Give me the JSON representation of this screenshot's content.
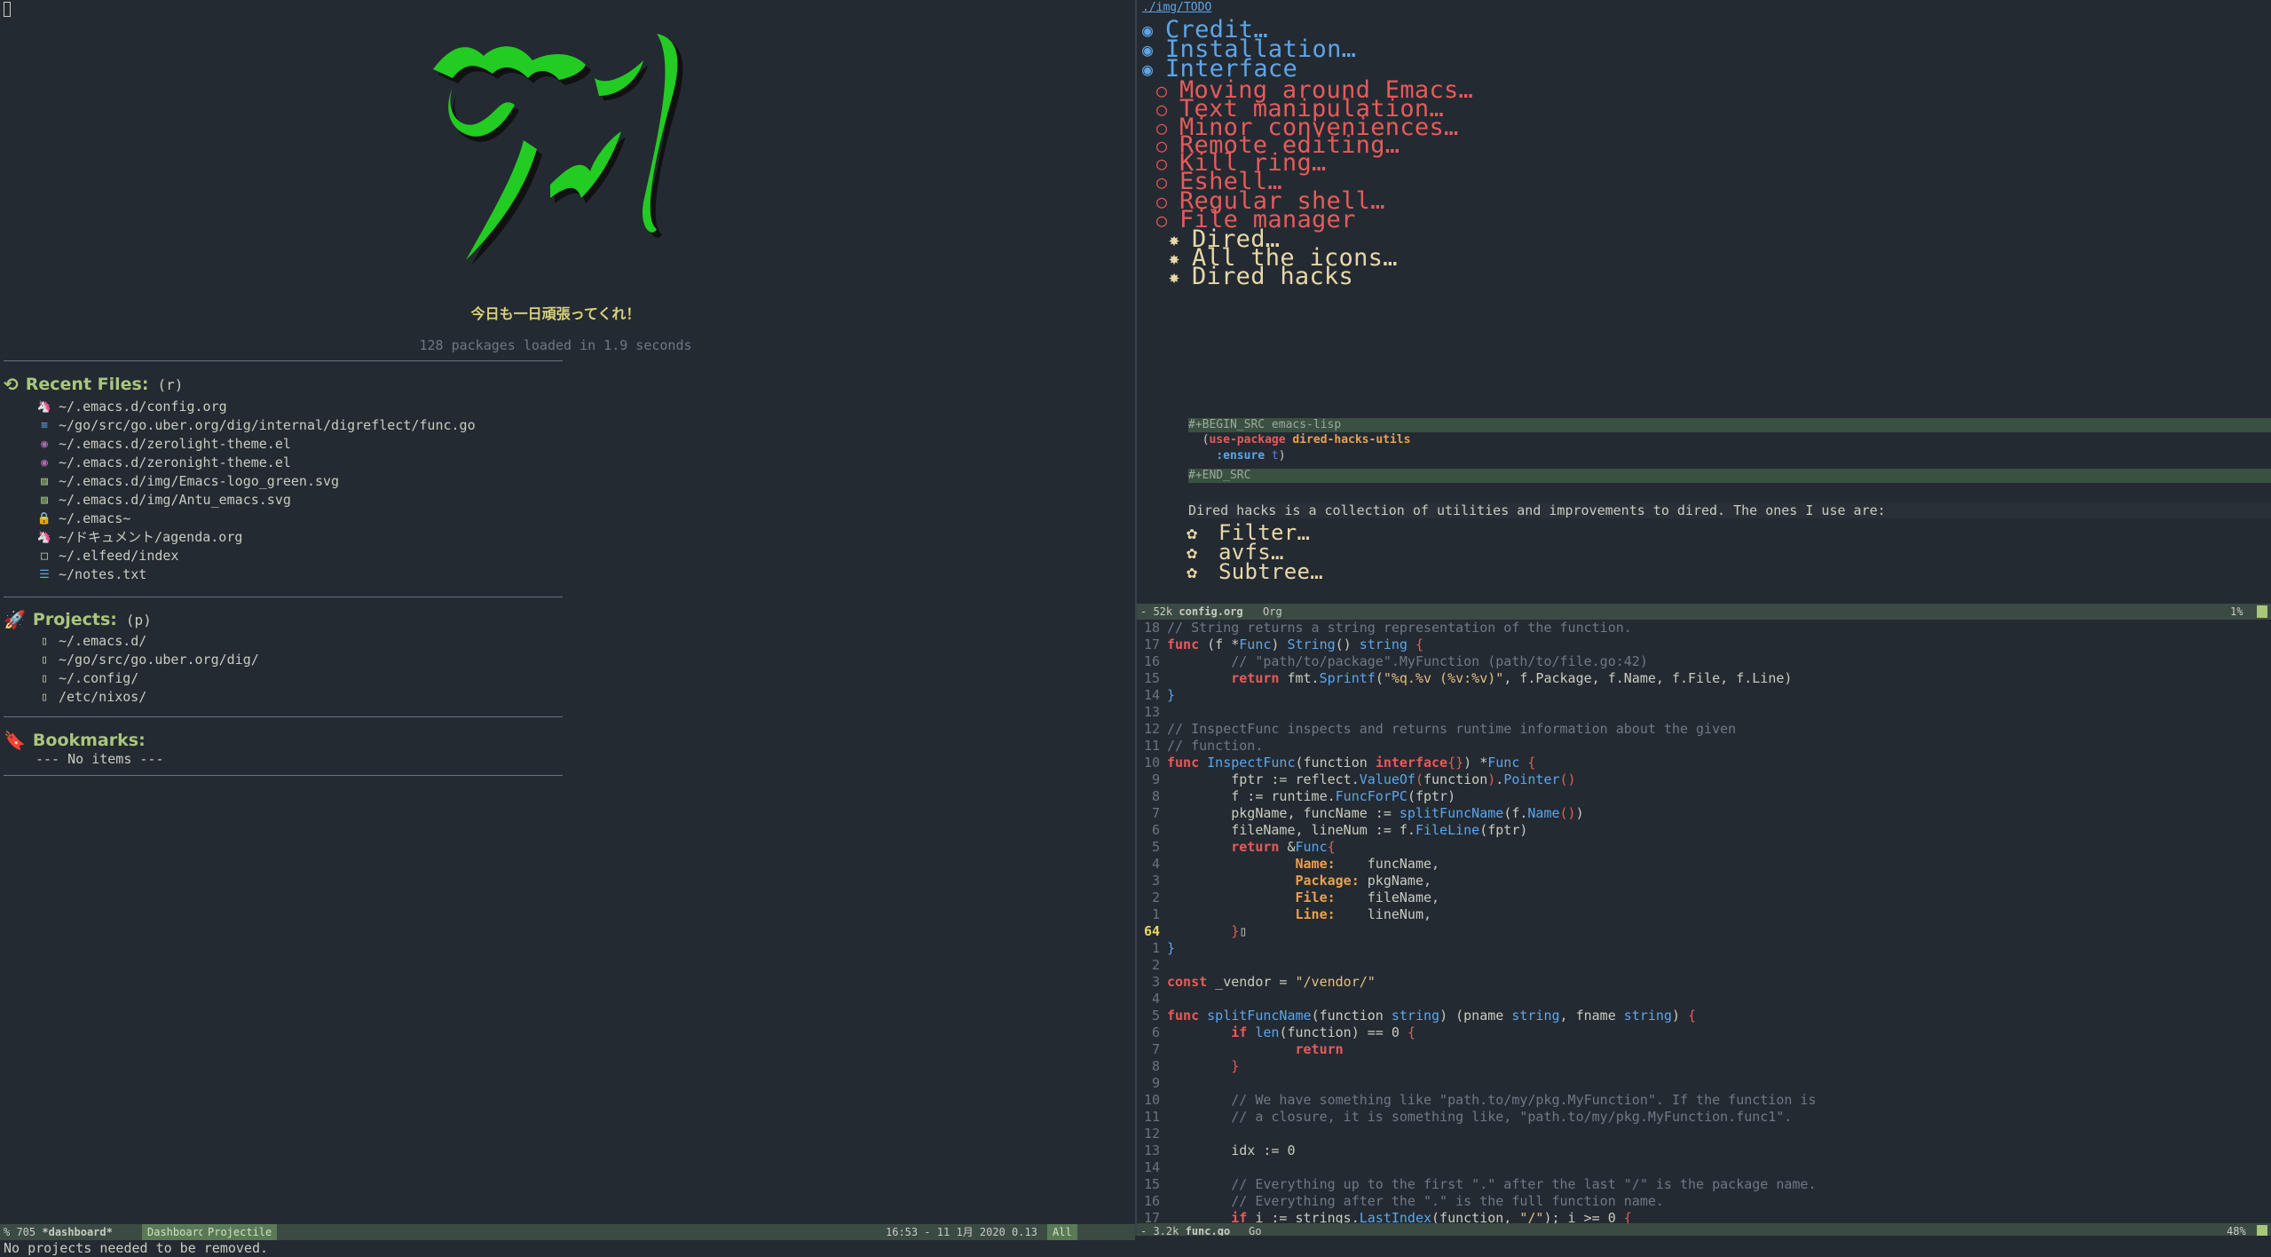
{
  "dashboard": {
    "banner_title": "今日も一日頑張ってくれ！",
    "loaded_text": "128 packages loaded in 1.9 seconds",
    "recent": {
      "title": "Recent Files:",
      "key": "(r)",
      "items": [
        {
          "path": "~/.emacs.d/config.org",
          "icon": "unicorn-icon",
          "glyph": "🦄",
          "color": "#e8d8a8"
        },
        {
          "path": "~/go/src/go.uber.org/dig/internal/digreflect/func.go",
          "icon": "go-file-icon",
          "glyph": "≡",
          "color": "#5ea5e8"
        },
        {
          "path": "~/.emacs.d/zerolight-theme.el",
          "icon": "elisp-icon",
          "glyph": "◉",
          "color": "#b06ab0"
        },
        {
          "path": "~/.emacs.d/zeronight-theme.el",
          "icon": "elisp-icon",
          "glyph": "◉",
          "color": "#b06ab0"
        },
        {
          "path": "~/.emacs.d/img/Emacs-logo_green.svg",
          "icon": "svg-image-icon",
          "glyph": "▨",
          "color": "#a9c67c"
        },
        {
          "path": "~/.emacs.d/img/Antu_emacs.svg",
          "icon": "svg-image-icon",
          "glyph": "▨",
          "color": "#a9c67c"
        },
        {
          "path": "~/.emacs~",
          "icon": "lock-icon",
          "glyph": "🔒",
          "color": "#e85a5a"
        },
        {
          "path": "~/ドキュメント/agenda.org",
          "icon": "unicorn-icon",
          "glyph": "🦄",
          "color": "#e8d8a8"
        },
        {
          "path": "~/.elfeed/index",
          "icon": "file-icon",
          "glyph": "□",
          "color": "#c8ccc0"
        },
        {
          "path": "~/notes.txt",
          "icon": "text-file-icon",
          "glyph": "☰",
          "color": "#5ea5e8"
        }
      ]
    },
    "projects": {
      "title": "Projects:",
      "key": "(p)",
      "items": [
        {
          "path": "~/.emacs.d/",
          "icon": "repo-icon",
          "glyph": "▯"
        },
        {
          "path": "~/go/src/go.uber.org/dig/",
          "icon": "repo-icon",
          "glyph": "▯"
        },
        {
          "path": "~/.config/",
          "icon": "repo-icon",
          "glyph": "▯"
        },
        {
          "path": "/etc/nixos/",
          "icon": "repo-icon",
          "glyph": "▯"
        }
      ]
    },
    "bookmarks": {
      "title": "Bookmarks:",
      "empty": "--- No items ---"
    }
  },
  "org": {
    "breadcrumb": "./img/TODO",
    "headings": [
      {
        "level": 1,
        "text": "Credit…",
        "bullet": "◉"
      },
      {
        "level": 1,
        "text": "Installation…",
        "bullet": "◉"
      },
      {
        "level": 1,
        "text": "Interface",
        "bullet": "◉"
      },
      {
        "level": 2,
        "text": "Moving around Emacs…",
        "bullet": "○"
      },
      {
        "level": 2,
        "text": "Text manipulation…",
        "bullet": "○"
      },
      {
        "level": 2,
        "text": "Minor conveniences…",
        "bullet": "○"
      },
      {
        "level": 2,
        "text": "Remote editing…",
        "bullet": "○"
      },
      {
        "level": 2,
        "text": "Kill ring…",
        "bullet": "○"
      },
      {
        "level": 2,
        "text": "Eshell…",
        "bullet": "○"
      },
      {
        "level": 2,
        "text": "Regular shell…",
        "bullet": "○"
      },
      {
        "level": 2,
        "text": "File manager",
        "bullet": "○"
      },
      {
        "level": 3,
        "text": "Dired…",
        "bullet": "✸"
      },
      {
        "level": 3,
        "text": "All the icons…",
        "bullet": "✸"
      },
      {
        "level": 3,
        "text": "Dired hacks",
        "bullet": "✸"
      }
    ],
    "src_begin": "#+BEGIN_SRC emacs-lisp",
    "src_line1_open": "  (",
    "src_line1_kw": "use-package",
    "src_line1_pkg": " dired-hacks-utils",
    "src_line2_indent": "    ",
    "src_line2_kw": ":ensure",
    "src_line2_val": " t",
    "src_line2_close": ")",
    "src_end": "#+END_SRC",
    "prose": "Dired hacks is a collection of utilities and improvements to dired. The ones I use are:",
    "subheadings": [
      {
        "text": "Filter…",
        "bullet": "✿"
      },
      {
        "text": "avfs…",
        "bullet": "✿"
      },
      {
        "text": "Subtree…",
        "bullet": "✿"
      }
    ],
    "modeline": {
      "size": "52k",
      "buffer": "config.org",
      "mode": "Org",
      "percent": "1%"
    }
  },
  "code": {
    "lines": [
      {
        "n": "18",
        "segs": [
          [
            "cmt",
            "// String returns a string representation of the function."
          ]
        ]
      },
      {
        "n": "17",
        "segs": [
          [
            "kw",
            "func"
          ],
          [
            "",
            " (f *"
          ],
          [
            "typ",
            "Func"
          ],
          [
            "",
            ") "
          ],
          [
            "fn",
            "String"
          ],
          [
            "",
            "() "
          ],
          [
            "typ",
            "string"
          ],
          [
            "",
            " "
          ],
          [
            "pnc",
            "{"
          ]
        ]
      },
      {
        "n": "16",
        "segs": [
          [
            "",
            "        "
          ],
          [
            "cmt",
            "// \"path/to/package\".MyFunction (path/to/file.go:42)"
          ]
        ]
      },
      {
        "n": "15",
        "segs": [
          [
            "",
            "        "
          ],
          [
            "kw",
            "return"
          ],
          [
            "",
            " fmt."
          ],
          [
            "fn",
            "Sprintf"
          ],
          [
            "",
            "("
          ],
          [
            "str",
            "\"%q.%v (%v:%v)\""
          ],
          [
            "",
            ", f.Package, f.Name, f.File, f.Line)"
          ]
        ]
      },
      {
        "n": "14",
        "segs": [
          [
            "typ",
            "}"
          ]
        ]
      },
      {
        "n": "13",
        "segs": []
      },
      {
        "n": "12",
        "segs": [
          [
            "cmt",
            "// InspectFunc inspects and returns runtime information about the given"
          ]
        ]
      },
      {
        "n": "11",
        "segs": [
          [
            "cmt",
            "// function."
          ]
        ]
      },
      {
        "n": "10",
        "segs": [
          [
            "kw",
            "func"
          ],
          [
            "",
            " "
          ],
          [
            "fn",
            "InspectFunc"
          ],
          [
            "",
            "(function "
          ],
          [
            "kw",
            "interface"
          ],
          [
            "pnc",
            "{}"
          ],
          [
            "",
            ") *"
          ],
          [
            "typ",
            "Func"
          ],
          [
            "",
            " "
          ],
          [
            "pnc",
            "{"
          ]
        ]
      },
      {
        "n": "9",
        "segs": [
          [
            "",
            "        fptr := reflect."
          ],
          [
            "fn",
            "ValueOf"
          ],
          [
            "pnc",
            "("
          ],
          [
            "",
            "function"
          ],
          [
            "pnc",
            ")"
          ],
          [
            "",
            "."
          ],
          [
            "fn",
            "Pointer"
          ],
          [
            "pnc",
            "()"
          ]
        ]
      },
      {
        "n": "8",
        "segs": [
          [
            "",
            "        f := runtime."
          ],
          [
            "fn",
            "FuncForPC"
          ],
          [
            "",
            "(fptr)"
          ]
        ]
      },
      {
        "n": "7",
        "segs": [
          [
            "",
            "        pkgName, funcName := "
          ],
          [
            "fn",
            "splitFuncName"
          ],
          [
            "",
            "(f."
          ],
          [
            "fn",
            "Name"
          ],
          [
            "pnc",
            "()"
          ],
          [
            "",
            ")"
          ]
        ]
      },
      {
        "n": "6",
        "segs": [
          [
            "",
            "        fileName, lineNum := f."
          ],
          [
            "fn",
            "FileLine"
          ],
          [
            "",
            "(fptr)"
          ]
        ]
      },
      {
        "n": "5",
        "segs": [
          [
            "",
            "        "
          ],
          [
            "kw",
            "return"
          ],
          [
            "",
            " &"
          ],
          [
            "typ",
            "Func"
          ],
          [
            "pnc",
            "{"
          ]
        ]
      },
      {
        "n": "4",
        "segs": [
          [
            "",
            "                "
          ],
          [
            "fld",
            "Name:"
          ],
          [
            "",
            "    funcName,"
          ]
        ]
      },
      {
        "n": "3",
        "segs": [
          [
            "",
            "                "
          ],
          [
            "fld",
            "Package:"
          ],
          [
            "",
            " pkgName,"
          ]
        ]
      },
      {
        "n": "2",
        "segs": [
          [
            "",
            "                "
          ],
          [
            "fld",
            "File:"
          ],
          [
            "",
            "    fileName,"
          ]
        ]
      },
      {
        "n": "1",
        "segs": [
          [
            "",
            "                "
          ],
          [
            "fld",
            "Line:"
          ],
          [
            "",
            "    lineNum,"
          ]
        ]
      },
      {
        "n": "64",
        "cur": true,
        "segs": [
          [
            "",
            "        "
          ],
          [
            "pnc",
            "}"
          ],
          [
            "",
            "▯"
          ]
        ]
      },
      {
        "n": "1",
        "segs": [
          [
            "typ",
            "}"
          ]
        ]
      },
      {
        "n": "2",
        "segs": []
      },
      {
        "n": "3",
        "segs": [
          [
            "kw",
            "const"
          ],
          [
            "",
            " _vendor = "
          ],
          [
            "str",
            "\"/vendor/\""
          ]
        ]
      },
      {
        "n": "4",
        "segs": []
      },
      {
        "n": "5",
        "segs": [
          [
            "kw",
            "func"
          ],
          [
            "",
            " "
          ],
          [
            "fn",
            "splitFuncName"
          ],
          [
            "",
            "(function "
          ],
          [
            "typ",
            "string"
          ],
          [
            "",
            ") (pname "
          ],
          [
            "typ",
            "string"
          ],
          [
            "",
            ", fname "
          ],
          [
            "typ",
            "string"
          ],
          [
            "",
            ") "
          ],
          [
            "pnc",
            "{"
          ]
        ]
      },
      {
        "n": "6",
        "segs": [
          [
            "",
            "        "
          ],
          [
            "kw",
            "if"
          ],
          [
            "",
            " "
          ],
          [
            "fn",
            "len"
          ],
          [
            "",
            "(function) == 0 "
          ],
          [
            "pnc",
            "{"
          ]
        ]
      },
      {
        "n": "7",
        "segs": [
          [
            "",
            "                "
          ],
          [
            "kw",
            "return"
          ]
        ]
      },
      {
        "n": "8",
        "segs": [
          [
            "",
            "        "
          ],
          [
            "pnc",
            "}"
          ]
        ]
      },
      {
        "n": "9",
        "segs": []
      },
      {
        "n": "10",
        "segs": [
          [
            "",
            "        "
          ],
          [
            "cmt",
            "// We have something like \"path.to/my/pkg.MyFunction\". If the function is"
          ]
        ]
      },
      {
        "n": "11",
        "segs": [
          [
            "",
            "        "
          ],
          [
            "cmt",
            "// a closure, it is something like, \"path.to/my/pkg.MyFunction.func1\"."
          ]
        ]
      },
      {
        "n": "12",
        "segs": []
      },
      {
        "n": "13",
        "segs": [
          [
            "",
            "        idx := 0"
          ]
        ]
      },
      {
        "n": "14",
        "segs": []
      },
      {
        "n": "15",
        "segs": [
          [
            "",
            "        "
          ],
          [
            "cmt",
            "// Everything up to the first \".\" after the last \"/\" is the package name."
          ]
        ]
      },
      {
        "n": "16",
        "segs": [
          [
            "",
            "        "
          ],
          [
            "cmt",
            "// Everything after the \".\" is the full function name."
          ]
        ]
      },
      {
        "n": "17",
        "segs": [
          [
            "",
            "        "
          ],
          [
            "kw",
            "if"
          ],
          [
            "",
            " i := strings."
          ],
          [
            "fn",
            "LastIndex"
          ],
          [
            "",
            "(function, "
          ],
          [
            "str",
            "\"/\""
          ],
          [
            "",
            "); i >= 0 "
          ],
          [
            "pnc",
            "{"
          ]
        ]
      }
    ],
    "modeline": {
      "size": "3.2k",
      "buffer": "func.go",
      "mode": "Go",
      "percent": "48%"
    }
  },
  "left_modeline": {
    "size": "705",
    "buffer": "*dashboard*",
    "mode1": "Dashboard",
    "mode2": "Projectile",
    "time": "16:53 - 11 1月 2020 0.13",
    "pos": "All"
  },
  "echo": "No projects needed to be removed.",
  "colors": {
    "bg": "#242a32",
    "green": "#a9c67c",
    "blue": "#5ea5e8",
    "red": "#e85a5a",
    "logo": "#22cc22"
  }
}
